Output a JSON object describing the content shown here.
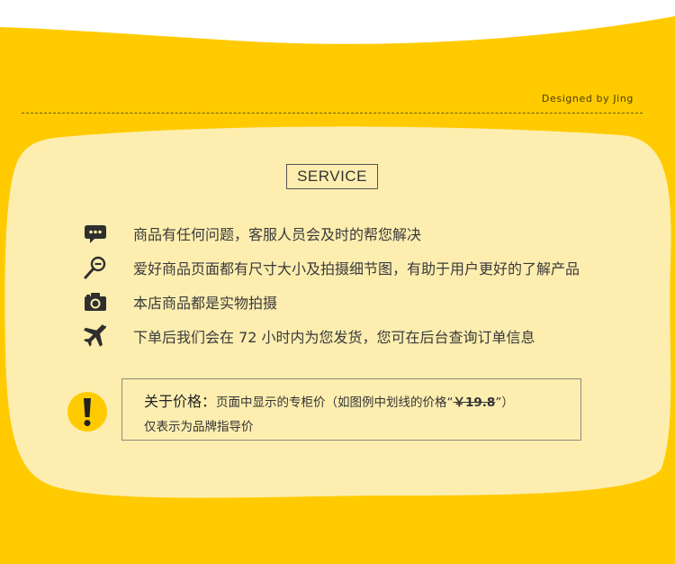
{
  "designer": "Designed  by Jing",
  "service_title": "SERVICE",
  "services": [
    {
      "icon": "chat-bubble-icon",
      "text": "商品有任何问题，客服人员会及时的帮您解决"
    },
    {
      "icon": "magnifier-icon",
      "text": "爱好商品页面都有尺寸大小及拍摄细节图，有助于用户更好的了解产品"
    },
    {
      "icon": "camera-icon",
      "text": "本店商品都是实物拍摄"
    },
    {
      "icon": "airplane-icon",
      "text": "下单后我们会在 72 小时内为您发货，您可在后台查询订单信息"
    }
  ],
  "price_notice": {
    "label": "关于价格：",
    "line1_before": "页面中显示的专柜价（如图例中划线的价格“",
    "example_price": "￥19.8",
    "line1_after": "”）",
    "line2": "仅表示为品牌指导价"
  },
  "colors": {
    "background": "#ffcb00",
    "panel": "#fdeeb0",
    "text": "#3a3a3a",
    "icon": "#2f2f2f",
    "warning": "#ffcb00"
  }
}
